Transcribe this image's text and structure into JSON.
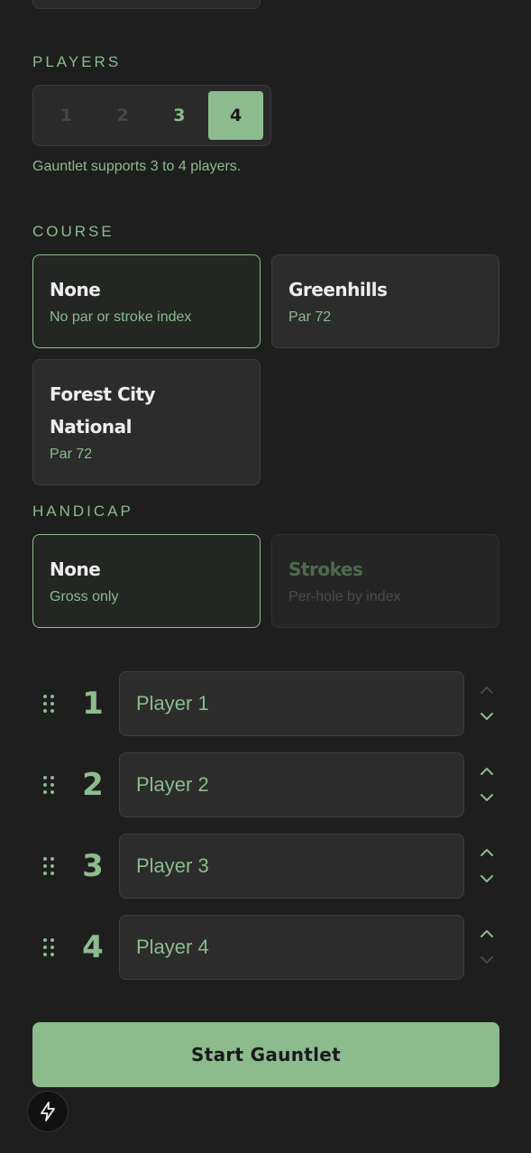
{
  "players_section": {
    "label": "PLAYERS",
    "options": [
      "1",
      "2",
      "3",
      "4"
    ],
    "selected": "4",
    "hint": "Gauntlet supports 3 to 4 players."
  },
  "course_section": {
    "label": "COURSE",
    "options": [
      {
        "title": "None",
        "subtitle": "No par or stroke index"
      },
      {
        "title": "Greenhills",
        "subtitle": "Par 72"
      },
      {
        "title_line1": "Forest City",
        "title_line2": "National",
        "subtitle": "Par 72"
      }
    ],
    "selected": "None"
  },
  "handicap_section": {
    "label": "HANDICAP",
    "options": [
      {
        "title": "None",
        "subtitle": "Gross only"
      },
      {
        "title": "Strokes",
        "subtitle": "Per-hole by index"
      }
    ],
    "selected": "None"
  },
  "player_rows": [
    {
      "number": "1",
      "placeholder": "Player 1"
    },
    {
      "number": "2",
      "placeholder": "Player 2"
    },
    {
      "number": "3",
      "placeholder": "Player 3"
    },
    {
      "number": "4",
      "placeholder": "Player 4"
    }
  ],
  "start_button": {
    "label": "Start Gauntlet"
  },
  "icons": {
    "drag": "grip-dots-icon",
    "move_up": "chevron-up-icon",
    "move_down": "chevron-down-icon",
    "dev": "lightning-bolt-icon"
  },
  "colors": {
    "background": "#1e1e1e",
    "accent": "#8cbb8e",
    "card": "#2c2c2c",
    "title_text": "#ededed"
  }
}
